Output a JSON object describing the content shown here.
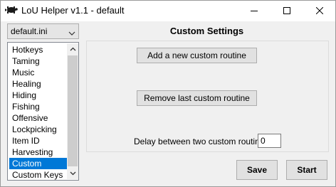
{
  "window": {
    "title": "LoU Helper v1.1 - default",
    "icons": {
      "app": "turtle-icon",
      "minimize": "minimize-icon",
      "maximize": "maximize-icon",
      "close": "close-icon"
    }
  },
  "profile": {
    "selected": "default.ini"
  },
  "sidebar": {
    "items": [
      {
        "label": "Hotkeys"
      },
      {
        "label": "Taming"
      },
      {
        "label": "Music"
      },
      {
        "label": "Healing"
      },
      {
        "label": "Hiding"
      },
      {
        "label": "Fishing"
      },
      {
        "label": "Offensive"
      },
      {
        "label": "Lockpicking"
      },
      {
        "label": "Item ID"
      },
      {
        "label": "Harvesting"
      },
      {
        "label": "Custom"
      },
      {
        "label": "Custom Keys"
      }
    ],
    "selected_index": 10
  },
  "custom_settings": {
    "title": "Custom Settings",
    "add_button": "Add a new custom routine",
    "remove_button": "Remove last custom routine",
    "delay_label": "Delay between two custom routines",
    "delay_value": "0"
  },
  "footer": {
    "save_label": "Save",
    "start_label": "Start"
  },
  "colors": {
    "selection": "#0078d7",
    "window_bg": "#f0f0f0"
  }
}
